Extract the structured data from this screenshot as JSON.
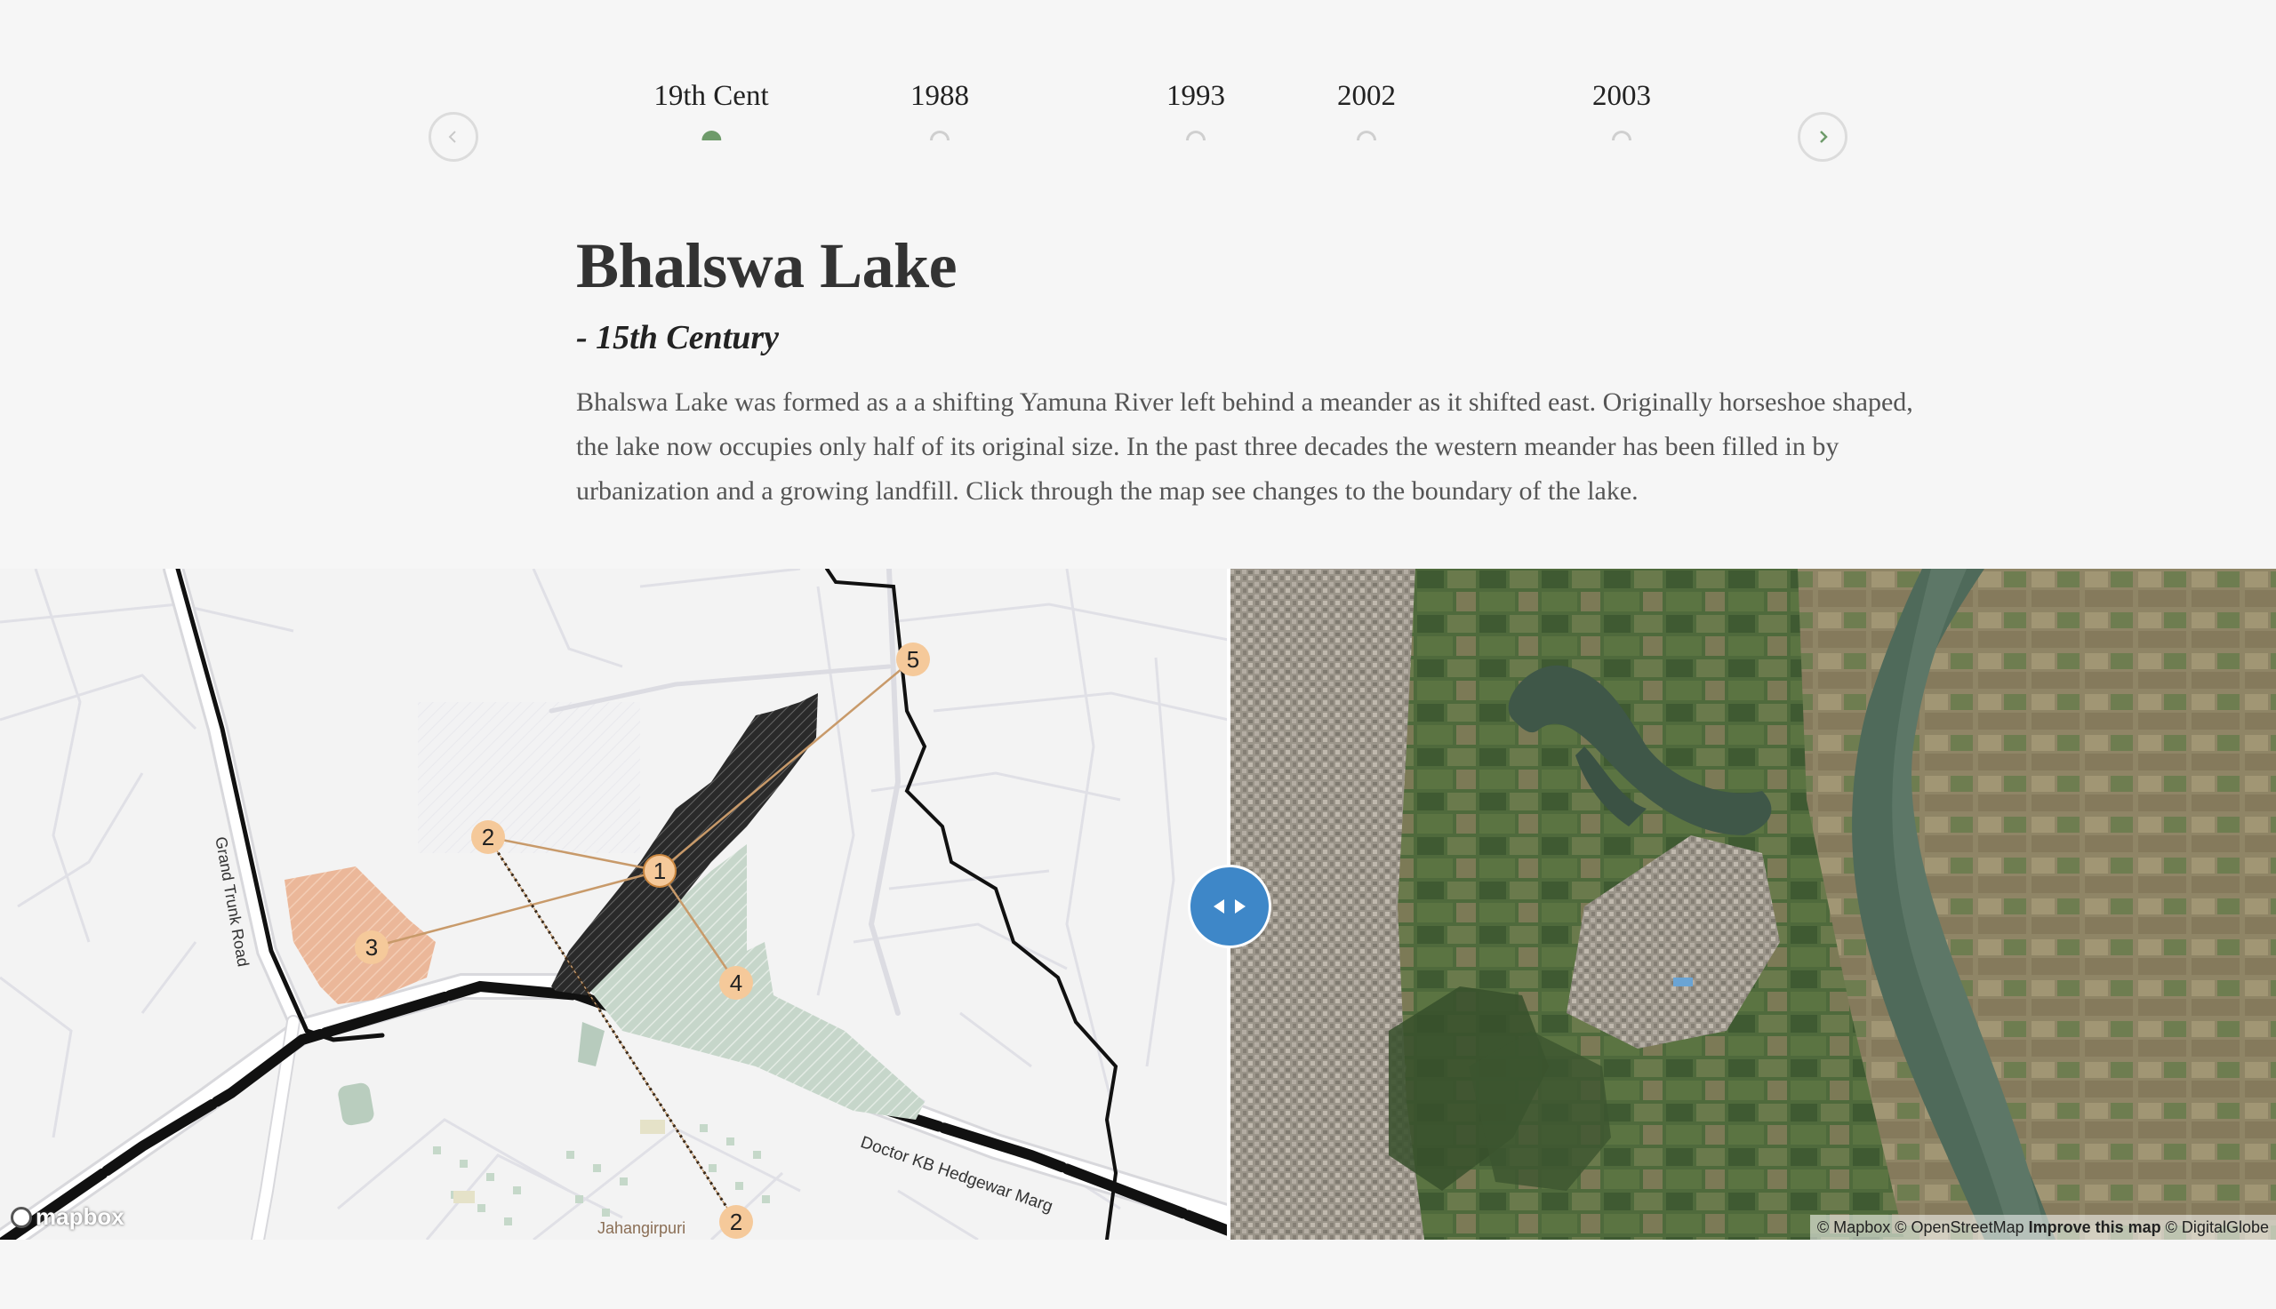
{
  "timeline": {
    "items": [
      {
        "label": "19th Cent",
        "active": true
      },
      {
        "label": "1988",
        "active": false
      },
      {
        "label": "1993",
        "active": false
      },
      {
        "label": "2002",
        "active": false
      },
      {
        "label": "2003",
        "active": false
      }
    ],
    "prev_icon": "chevron-left-icon",
    "next_icon": "chevron-right-icon",
    "accent": "#6e9b6a"
  },
  "content": {
    "title": "Bhalswa Lake",
    "subtitle": "- 15th Century",
    "description": "Bhalswa Lake was formed as a a shifting Yamuna River left behind a meander as it shifted east. Originally horseshoe shaped, the lake now occupies only half of its original size. In the past three decades the western meander has been filled in by urbanization and a growing landfill. Click through the map see changes to the boundary of the lake."
  },
  "map": {
    "labels": {
      "grand_trunk_road": "Grand Trunk Road",
      "doctor_kb_marg": "Doctor KB Hedgewar Marg",
      "jahangirpuri": "Jahangirpuri"
    },
    "markers": [
      "1",
      "2",
      "3",
      "4",
      "5",
      "2"
    ],
    "logo": "mapbox",
    "attribution": {
      "mapbox": "© Mapbox",
      "osm": "© OpenStreetMap",
      "improve": "Improve this map",
      "digitalglobe": "© DigitalGlobe"
    },
    "colors": {
      "marker": "#f5c99a",
      "landfill": "#e8b496",
      "lake_outline": "#222222",
      "green_area": "#b9cdbe",
      "slider": "#3e87c8"
    }
  }
}
